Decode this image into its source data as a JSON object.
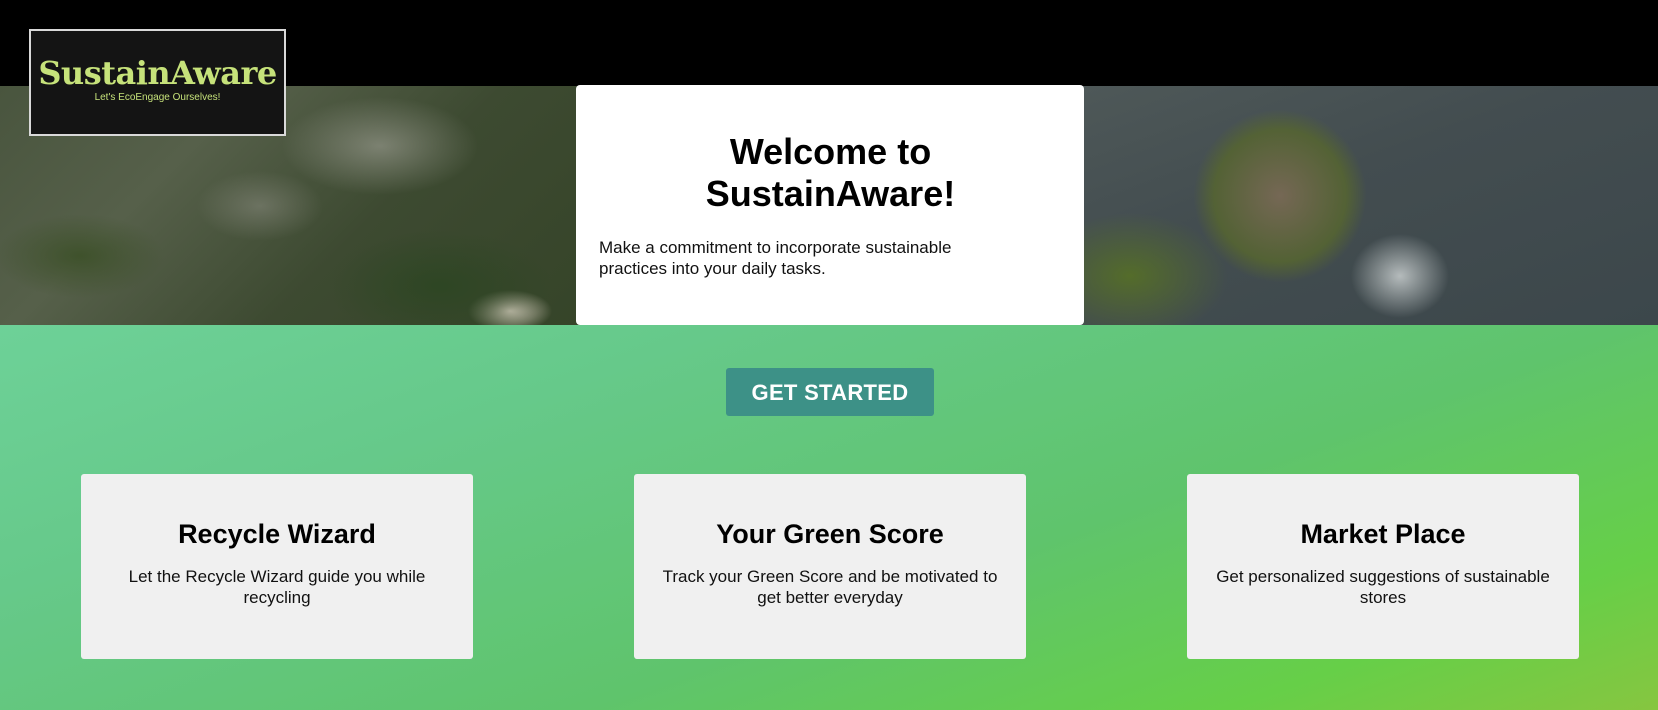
{
  "brand": {
    "name": "SustainAware",
    "tagline": "Let's EcoEngage Ourselves!"
  },
  "hero": {
    "title": "Welcome to SustainAware!",
    "description": "Make a commitment to incorporate sustainable practices into your daily tasks."
  },
  "cta": {
    "label": "GET STARTED"
  },
  "features": [
    {
      "title": "Recycle Wizard",
      "description": "Let the Recycle Wizard guide you while recycling"
    },
    {
      "title": "Your Green Score",
      "description": "Track your Green Score and be motivated to get better everyday"
    },
    {
      "title": "Market Place",
      "description": "Get personalized suggestions of sustainable stores"
    }
  ],
  "colors": {
    "brand_accent": "#c6e27a",
    "button": "#3d9187",
    "card_background": "#f0f0f0"
  }
}
